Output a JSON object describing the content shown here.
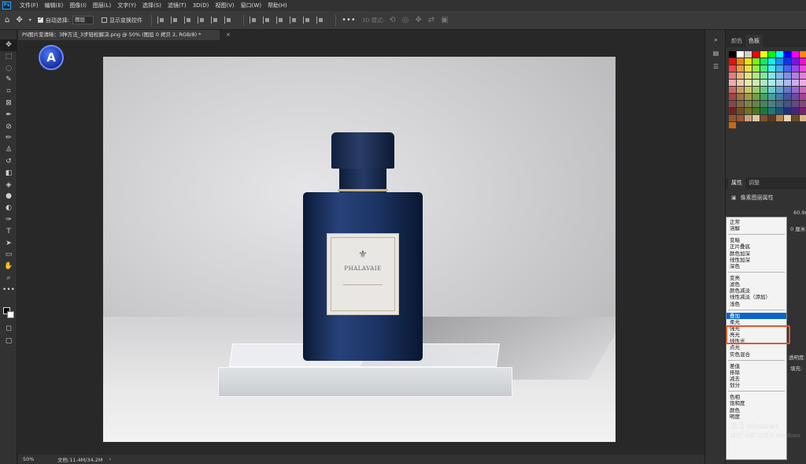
{
  "app": {
    "logo": "Ps"
  },
  "menu": [
    "文件(F)",
    "编辑(E)",
    "图像(I)",
    "图层(L)",
    "文字(Y)",
    "选择(S)",
    "滤镜(T)",
    "3D(D)",
    "视图(V)",
    "窗口(W)",
    "帮助(H)"
  ],
  "options": {
    "auto_select_label": "自动选择:",
    "auto_select_value": "图层",
    "transform_controls_label": "显示变换控件",
    "mode_3d": "3D 模式:"
  },
  "document": {
    "tab_title": "PS图片变清晰：3种方法_3步轻松解决.png @ 50% (图层 0 拷贝 2, RGB/8) *",
    "zoom": "50%",
    "doc_info": "文档:11.4M/34.2M"
  },
  "artwork": {
    "logo_letter": "A",
    "label_brand": "PHALAVAIE"
  },
  "panels": {
    "top_tabs": [
      "颜色",
      "色板"
    ],
    "bottom_tabs": [
      "属性",
      "调整"
    ],
    "properties_title": "像素图层属性",
    "fragments": [
      "60.96",
      "0 厘米",
      "透明度:",
      "填充:"
    ]
  },
  "blend_groups": [
    [
      "正常",
      "溶解"
    ],
    [
      "变暗",
      "正片叠底",
      "颜色加深",
      "线性加深",
      "深色"
    ],
    [
      "变亮",
      "滤色",
      "颜色减淡",
      "线性减淡（添加）",
      "浅色"
    ],
    [
      "叠加",
      "柔光",
      "强光",
      "亮光",
      "线性光",
      "点光",
      "实色混合"
    ],
    [
      "差值",
      "排除",
      "减去",
      "划分"
    ],
    [
      "色相",
      "饱和度",
      "颜色",
      "明度"
    ]
  ],
  "watermark": {
    "line1": "激活 Windows",
    "line2": "转到\"设置\"以激活 Windows"
  },
  "colors": {
    "selection": "#0a66c9",
    "highlight": "#e0572f"
  }
}
